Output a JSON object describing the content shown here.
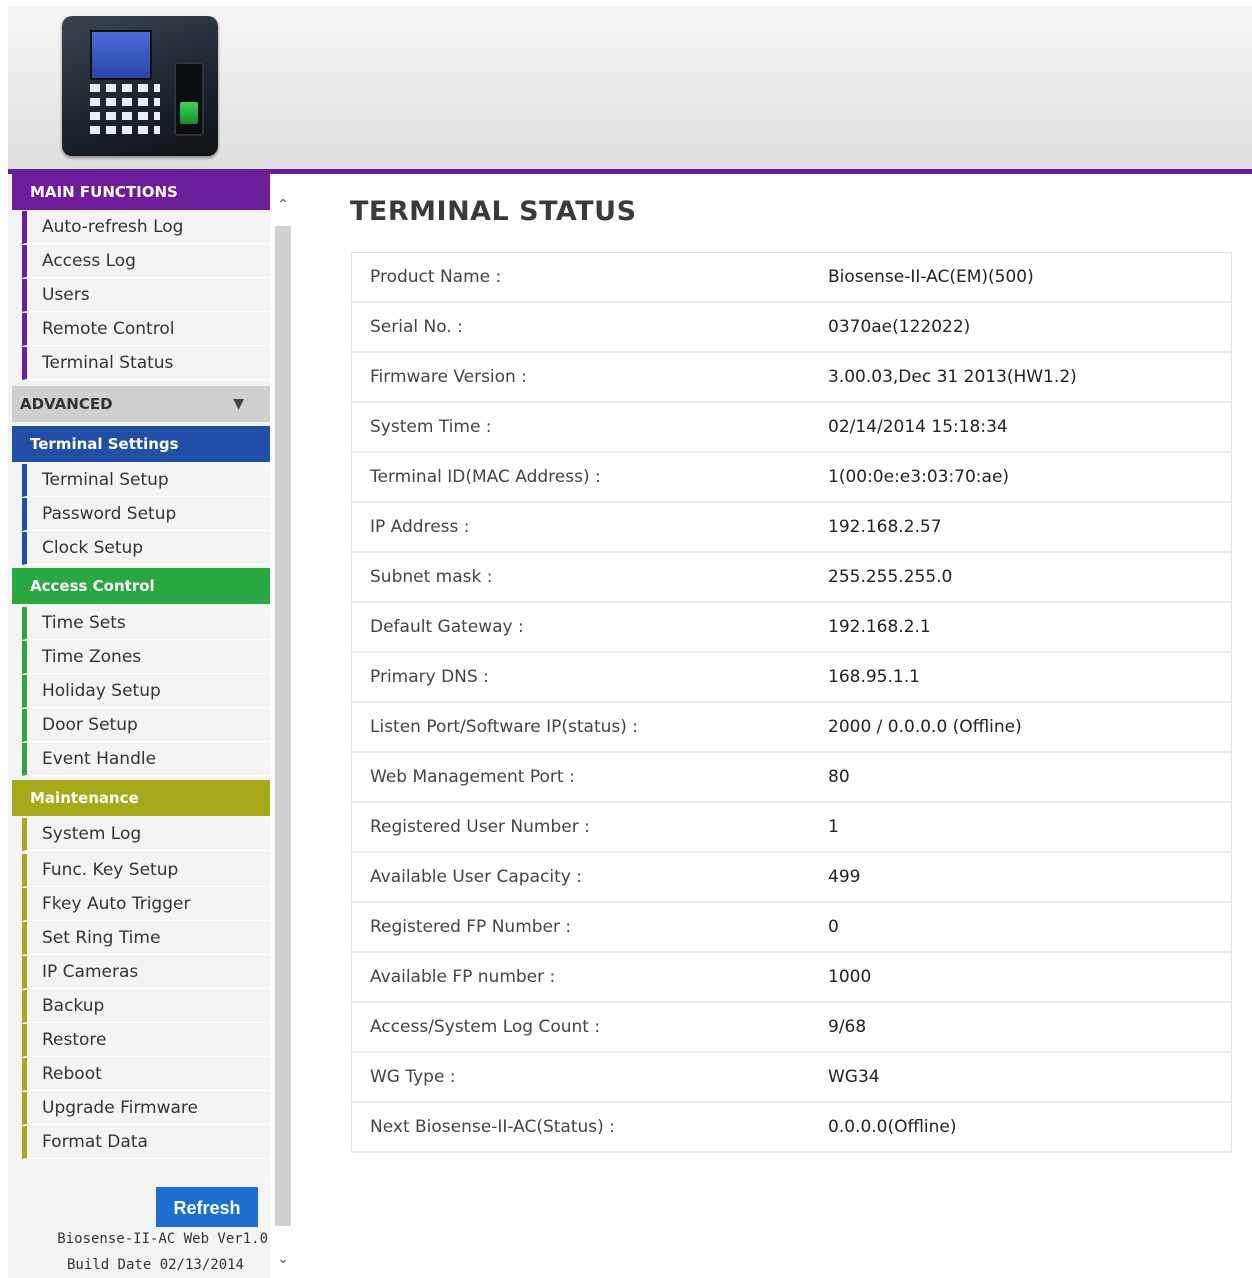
{
  "page_title": "TERMINAL STATUS",
  "colors": {
    "header_bar": "#6b1d9b",
    "main_functions": "#6b1d9b",
    "terminal_settings": "#214fa7",
    "access_control": "#27a840",
    "maintenance": "#a6aa18",
    "refresh_button": "#1c6fd0"
  },
  "sidebar": {
    "main_functions": {
      "title": "MAIN FUNCTIONS",
      "items": [
        "Auto-refresh Log",
        "Access Log",
        "Users",
        "Remote Control",
        "Terminal Status"
      ]
    },
    "advanced": {
      "title": "ADVANCED",
      "icon": "triangle-down-icon"
    },
    "terminal_settings": {
      "title": "Terminal Settings",
      "items": [
        "Terminal Setup",
        "Password Setup",
        "Clock Setup"
      ]
    },
    "access_control": {
      "title": "Access Control",
      "items": [
        "Time Sets",
        "Time Zones",
        "Holiday Setup",
        "Door Setup",
        "Event Handle"
      ]
    },
    "maintenance": {
      "title": "Maintenance",
      "items": [
        "System Log",
        "Func. Key Setup",
        "Fkey Auto Trigger",
        "Set Ring Time",
        "IP Cameras",
        "Backup",
        "Restore",
        "Reboot",
        "Upgrade Firmware",
        "Format Data"
      ]
    },
    "refresh_label": "Refresh",
    "version": "Biosense-II-AC Web Ver1.0",
    "build_date": "Build Date 02/13/2014"
  },
  "status_rows": [
    {
      "label": "Product Name :",
      "value": "Biosense-II-AC(EM)(500)"
    },
    {
      "label": "Serial No. :",
      "value": "0370ae(122022)"
    },
    {
      "label": "Firmware Version :",
      "value": "3.00.03,Dec 31 2013(HW1.2)"
    },
    {
      "label": "System Time :",
      "value": "02/14/2014 15:18:34"
    },
    {
      "label": "Terminal ID(MAC Address) :",
      "value": "1(00:0e:e3:03:70:ae)"
    },
    {
      "label": "IP Address :",
      "value": "192.168.2.57"
    },
    {
      "label": "Subnet mask :",
      "value": "255.255.255.0"
    },
    {
      "label": "Default Gateway :",
      "value": "192.168.2.1"
    },
    {
      "label": "Primary DNS :",
      "value": "168.95.1.1"
    },
    {
      "label": "Listen Port/Software IP(status) :",
      "value": "2000 / 0.0.0.0 (Offline)"
    },
    {
      "label": "Web Management Port :",
      "value": "80"
    },
    {
      "label": "Registered User Number :",
      "value": "1"
    },
    {
      "label": "Available User Capacity :",
      "value": "499"
    },
    {
      "label": "Registered FP Number :",
      "value": "0"
    },
    {
      "label": "Available FP number :",
      "value": "1000"
    },
    {
      "label": "Access/System Log Count :",
      "value": "9/68"
    },
    {
      "label": "WG Type :",
      "value": "WG34"
    },
    {
      "label": "Next Biosense-II-AC(Status) :",
      "value": "0.0.0.0(Offline)"
    }
  ]
}
